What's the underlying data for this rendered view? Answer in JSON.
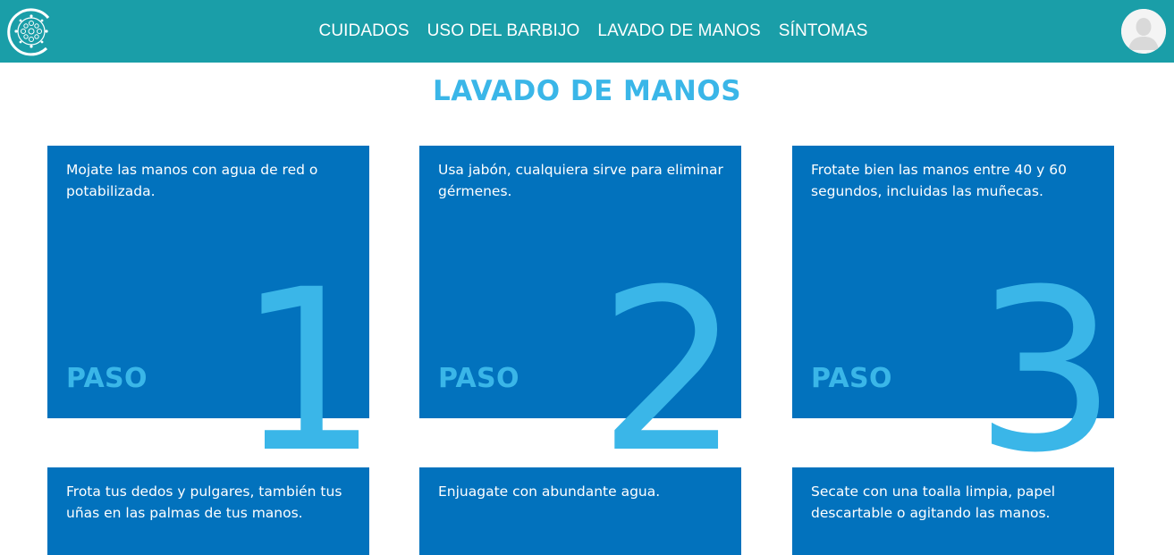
{
  "nav": {
    "items": [
      "CUIDADOS",
      "USO DEL BARBIJO",
      "LAVADO DE MANOS",
      "SÍNTOMAS"
    ],
    "logo_icon": "virus-logo-icon",
    "avatar_icon": "user-avatar-icon"
  },
  "page": {
    "title": "LAVADO DE MANOS"
  },
  "cards": [
    {
      "text": "Mojate las manos con agua de red o potabilizada.",
      "label": "PASO",
      "number": "1"
    },
    {
      "text": "Usa jabón, cualquiera sirve para eliminar gérmenes.",
      "label": "PASO",
      "number": "2"
    },
    {
      "text": "Frotate bien las manos entre 40 y 60 segundos, incluidas las muñecas.",
      "label": "PASO",
      "number": "3"
    },
    {
      "text": "Frota tus dedos y pulgares, también tus uñas en las palmas de tus manos."
    },
    {
      "text": "Enjuagate con abundante agua."
    },
    {
      "text": "Secate con una toalla limpia, papel descartable o agitando las manos."
    }
  ],
  "colors": {
    "navbar": "#1a9ea8",
    "card": "#0272bd",
    "accent": "#3ab6e8",
    "text": "#ffffff"
  }
}
